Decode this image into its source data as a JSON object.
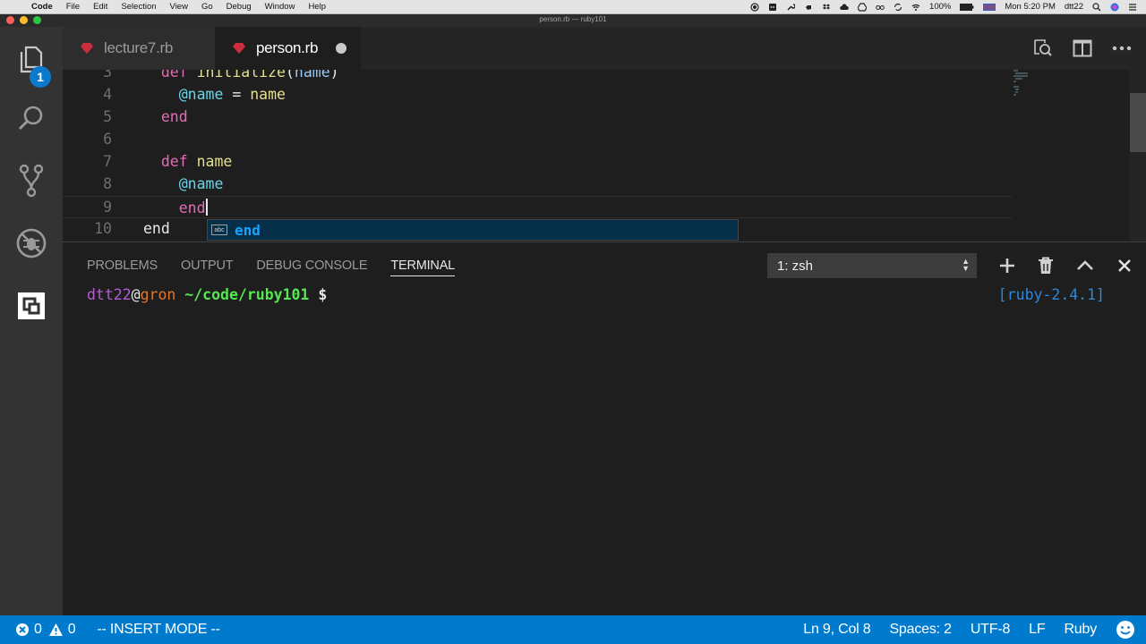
{
  "menubar": {
    "app_name": "Code",
    "menus": [
      "File",
      "Edit",
      "Selection",
      "View",
      "Go",
      "Debug",
      "Window",
      "Help"
    ],
    "battery": "100%",
    "clock": "Mon 5:20 PM",
    "user": "dtt22"
  },
  "window": {
    "title": "person.rb — ruby101"
  },
  "activity_bar": {
    "explorer_badge": "1"
  },
  "tabs": [
    {
      "label": "lecture7.rb",
      "active": false
    },
    {
      "label": "person.rb",
      "active": true,
      "dirty": true
    }
  ],
  "editor": {
    "lines": [
      {
        "num": "3",
        "indent": "  ",
        "tokens": [
          {
            "t": "def",
            "c": "kw"
          },
          {
            "t": " ",
            "c": "plain"
          },
          {
            "t": "initialize",
            "c": "fn"
          },
          {
            "t": "(",
            "c": "plain"
          },
          {
            "t": "name",
            "c": "param"
          },
          {
            "t": ")",
            "c": "plain"
          }
        ]
      },
      {
        "num": "4",
        "indent": "    ",
        "tokens": [
          {
            "t": "@name",
            "c": "ivar"
          },
          {
            "t": " = ",
            "c": "plain"
          },
          {
            "t": "name",
            "c": "fn"
          }
        ]
      },
      {
        "num": "5",
        "indent": "  ",
        "tokens": [
          {
            "t": "end",
            "c": "kw"
          }
        ]
      },
      {
        "num": "6",
        "indent": "",
        "tokens": []
      },
      {
        "num": "7",
        "indent": "  ",
        "tokens": [
          {
            "t": "def",
            "c": "kw"
          },
          {
            "t": " ",
            "c": "plain"
          },
          {
            "t": "name",
            "c": "fn"
          }
        ]
      },
      {
        "num": "8",
        "indent": "    ",
        "tokens": [
          {
            "t": "@name",
            "c": "ivar"
          }
        ]
      },
      {
        "num": "9",
        "indent": "    ",
        "tokens": [
          {
            "t": "end",
            "c": "kw"
          }
        ],
        "current": true,
        "cursor": true
      },
      {
        "num": "10",
        "indent": "",
        "tokens": [
          {
            "t": "end",
            "c": "plain"
          }
        ]
      }
    ]
  },
  "suggest": {
    "kind_label": "abc",
    "item": "end"
  },
  "panel": {
    "tabs": [
      {
        "label": "PROBLEMS",
        "active": false
      },
      {
        "label": "OUTPUT",
        "active": false
      },
      {
        "label": "DEBUG CONSOLE",
        "active": false
      },
      {
        "label": "TERMINAL",
        "active": true
      }
    ],
    "terminal_selected": "1: zsh",
    "prompt": {
      "user": "dtt22",
      "at": "@",
      "host": "gron",
      "path": "~/code/ruby101",
      "symbol": "$",
      "right": "[ruby-2.4.1]"
    }
  },
  "statusbar": {
    "errors": "0",
    "warnings": "0",
    "mode": "-- INSERT MODE --",
    "position": "Ln 9, Col 8",
    "spaces": "Spaces: 2",
    "encoding": "UTF-8",
    "eol": "LF",
    "language": "Ruby"
  },
  "colors": {
    "accent": "#007acc",
    "keyword": "#e86ab6",
    "function": "#e6df8f",
    "ivar": "#67d6e9"
  }
}
